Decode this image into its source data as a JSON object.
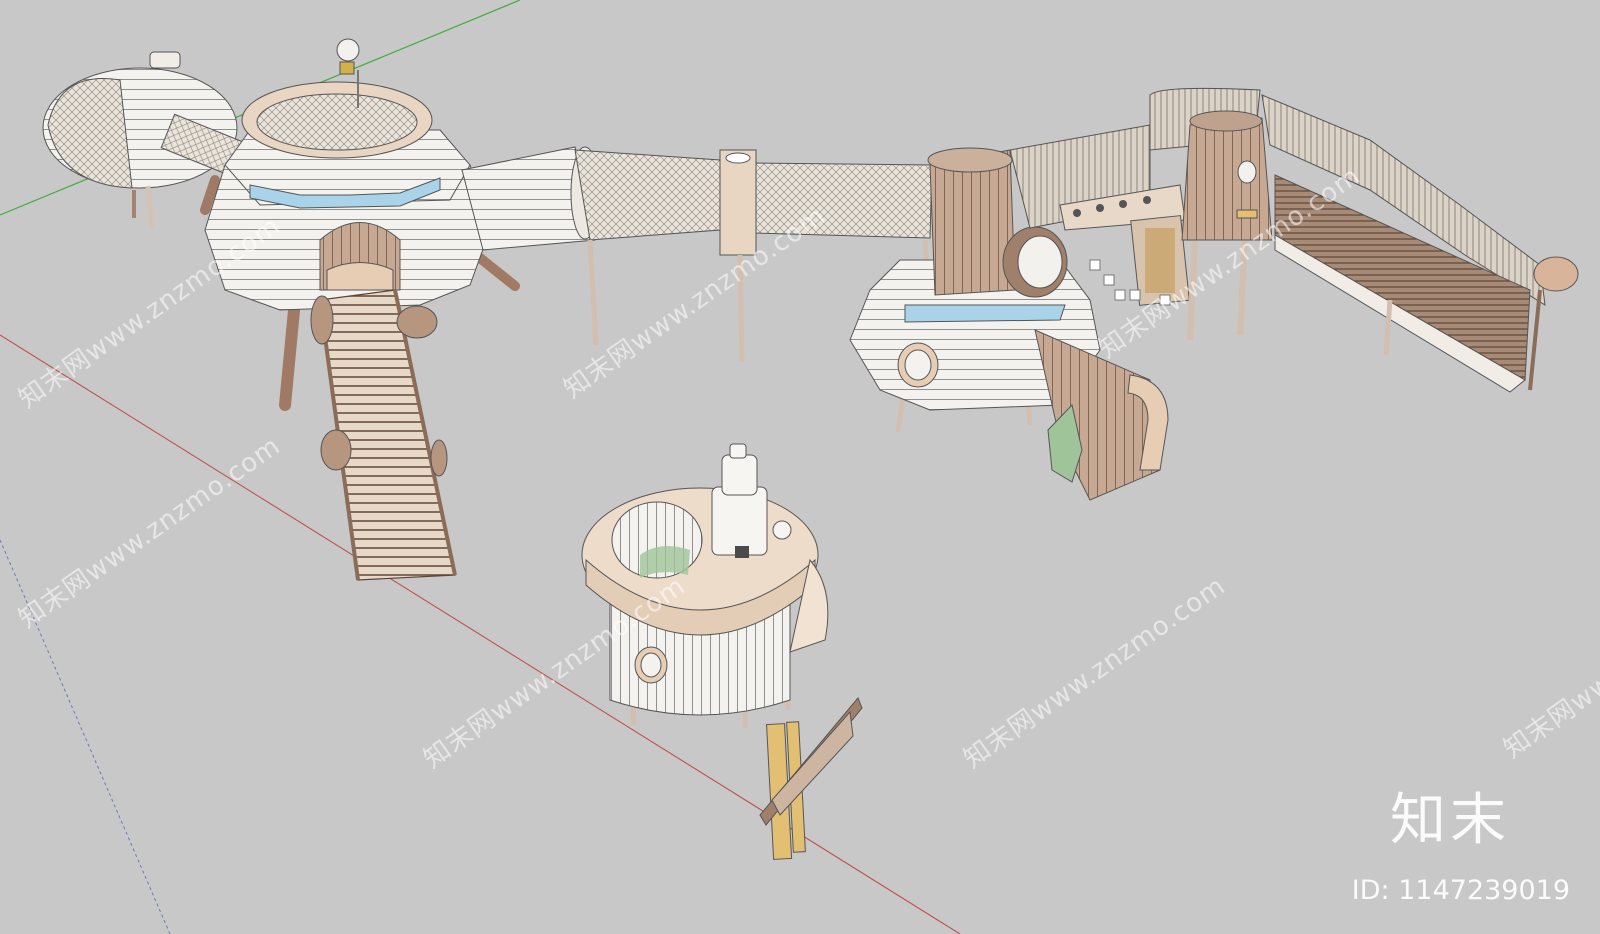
{
  "watermark": {
    "text": "知末网www.znzmo.com",
    "brand_cn": "知末",
    "id_label": "ID: 1147239019"
  },
  "colors": {
    "ground": "#c8c8c8",
    "white_panel": "#f3f1ed",
    "wood": "#b7967f",
    "wood_dark": "#8a6c59",
    "beige": "#e6cdb3",
    "post": "#b89a88",
    "axis_red": "#c05050",
    "axis_green": "#3fae3f",
    "axis_blue": "#6a7bb0",
    "glass": "#a9d3e8",
    "sign_yellow": "#e3bf73",
    "green_panel": "#9fc49a"
  },
  "icons": [
    "axis-red-line",
    "axis-green-line",
    "axis-blue-dashed-line"
  ]
}
